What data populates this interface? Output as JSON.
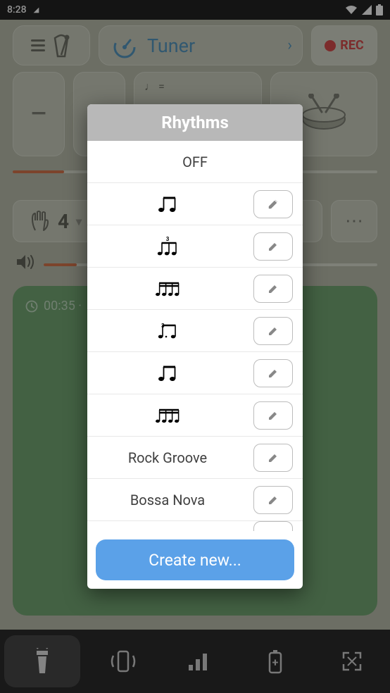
{
  "status": {
    "time": "8:28"
  },
  "top": {
    "tuner_label": "Tuner",
    "rec_label": "REC"
  },
  "tempo": {
    "note_eq": "♩ ="
  },
  "hand": {
    "beats": "4"
  },
  "green": {
    "time": "00:35 · "
  },
  "modal": {
    "title": "Rhythms",
    "off_label": "OFF",
    "items": {
      "0": {
        "icon": "eighth-pair"
      },
      "1": {
        "icon": "triplet"
      },
      "2": {
        "icon": "sixteenth-four"
      },
      "3": {
        "icon": "dotted-eighth"
      },
      "4": {
        "icon": "eighth-pair-2"
      },
      "5": {
        "icon": "sixteenth-four-2"
      },
      "6": {
        "label": "Rock Groove"
      },
      "7": {
        "label": "Bossa Nova"
      }
    },
    "create_label": "Create new..."
  }
}
